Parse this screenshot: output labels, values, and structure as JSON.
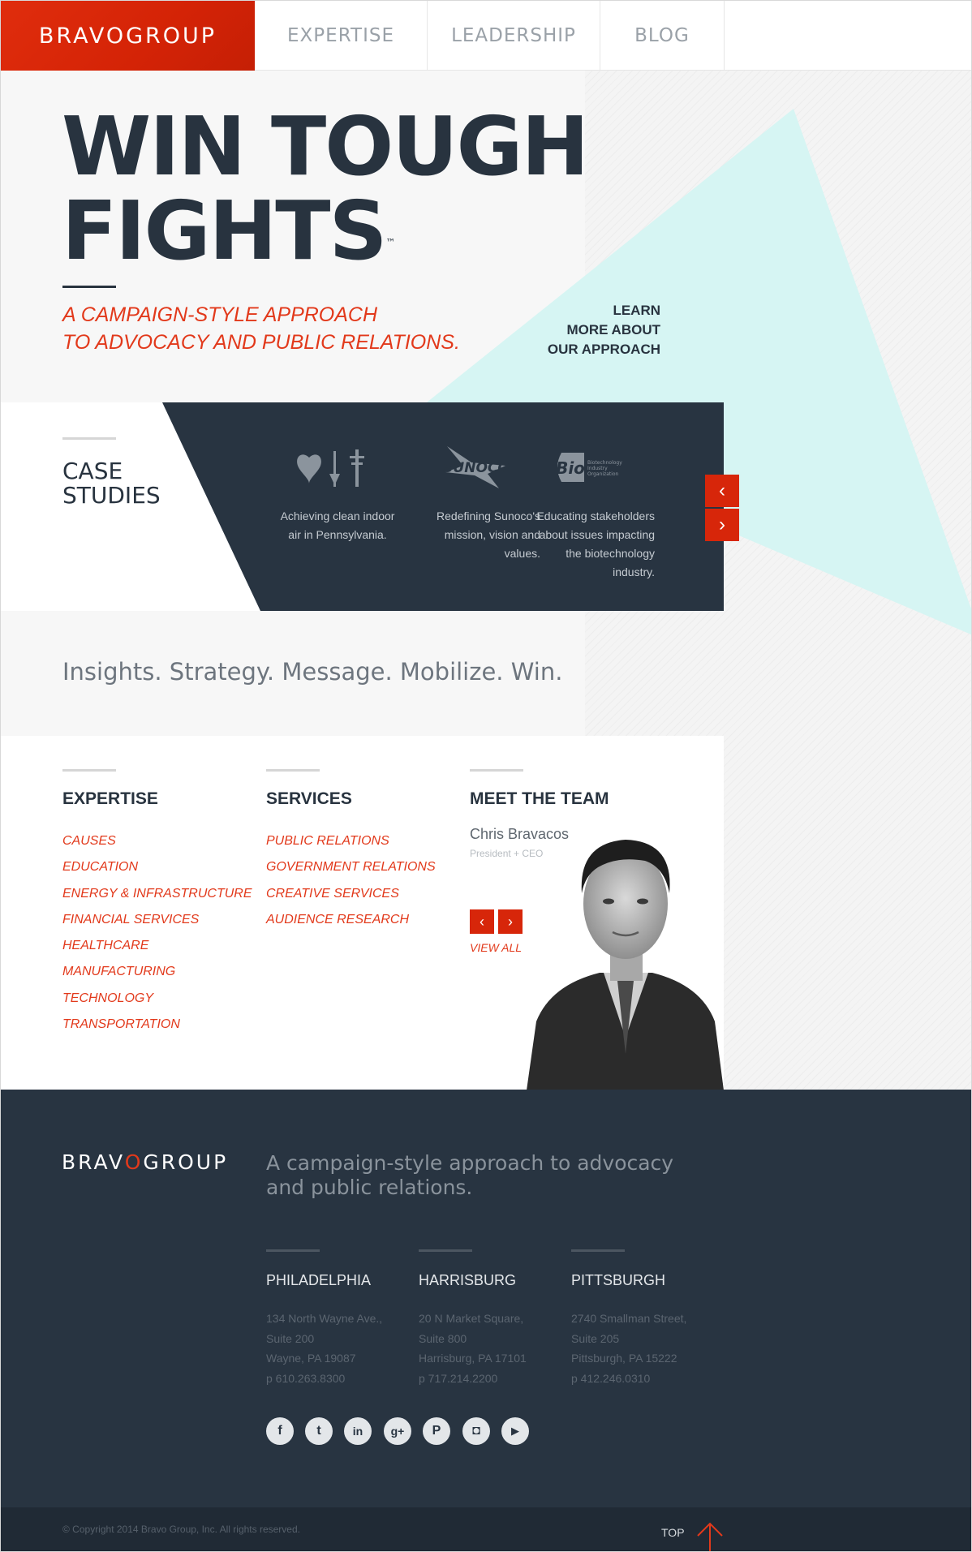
{
  "nav": {
    "logo": "BRAVOGROUP",
    "items": [
      "EXPERTISE",
      "LEADERSHIP",
      "BLOG"
    ]
  },
  "hero": {
    "title_line1": "WIN TOUGH",
    "title_line2": "FIGHTS",
    "trademark": "™",
    "subtitle_line1": "A CAMPAIGN-STYLE APPROACH",
    "subtitle_line2": "TO ADVOCACY AND PUBLIC RELATIONS.",
    "learn_more": [
      "LEARN",
      "MORE ABOUT",
      "OUR APPROACH"
    ]
  },
  "case_studies": {
    "title_line1": "CASE",
    "title_line2": "STUDIES",
    "items": [
      {
        "logo": "health-coalition-logo",
        "text": "Achieving clean indoor air in Pennsylvania."
      },
      {
        "logo": "sunoco-logo",
        "logo_text": "SUNOCO",
        "text": "Redefining Sunoco's mission, vision and values."
      },
      {
        "logo": "bio-logo",
        "logo_text": "Bio",
        "logo_subtext": "Biotechnology Industry Organization",
        "text": "Educating stakeholders about issues impacting the biotechnology industry."
      }
    ],
    "prev": "‹",
    "next": "›"
  },
  "tagline": "Insights. Strategy. Message. Mobilize. Win.",
  "expertise": {
    "heading": "EXPERTISE",
    "items": [
      "CAUSES",
      "EDUCATION",
      "ENERGY & INFRASTRUCTURE",
      "FINANCIAL SERVICES",
      "HEALTHCARE",
      "MANUFACTURING",
      "TECHNOLOGY",
      "TRANSPORTATION"
    ]
  },
  "services": {
    "heading": "SERVICES",
    "items": [
      "PUBLIC RELATIONS",
      "GOVERNMENT RELATIONS",
      "CREATIVE SERVICES",
      "AUDIENCE RESEARCH"
    ]
  },
  "team": {
    "heading": "MEET THE TEAM",
    "name": "Chris Bravacos",
    "role": "President + CEO",
    "prev": "‹",
    "next": "›",
    "view_all": "VIEW ALL"
  },
  "footer": {
    "logo_pre": "BRAV",
    "logo_o": "O",
    "logo_post": "GROUP",
    "tagline": "A campaign-style approach to advocacy and public relations.",
    "offices": [
      {
        "city": "PHILADELPHIA",
        "lines": [
          "134 North Wayne Ave.,",
          "Suite 200",
          "Wayne, PA 19087",
          "p 610.263.8300"
        ]
      },
      {
        "city": "HARRISBURG",
        "lines": [
          "20 N Market Square,",
          "Suite 800",
          "Harrisburg, PA 17101",
          "p 717.214.2200"
        ]
      },
      {
        "city": "PITTSBURGH",
        "lines": [
          "2740 Smallman Street,",
          "Suite 205",
          "Pittsburgh, PA 15222",
          "p 412.246.0310"
        ]
      }
    ],
    "social": [
      {
        "name": "facebook-icon",
        "glyph": "f"
      },
      {
        "name": "twitter-icon",
        "glyph": "t"
      },
      {
        "name": "linkedin-icon",
        "glyph": "in"
      },
      {
        "name": "google-plus-icon",
        "glyph": "g+"
      },
      {
        "name": "pinterest-icon",
        "glyph": "P"
      },
      {
        "name": "instagram-icon",
        "glyph": "◘"
      },
      {
        "name": "youtube-icon",
        "glyph": "▶"
      }
    ],
    "copyright": "© Copyright 2014 Bravo Group, Inc. All rights reserved.",
    "top": "TOP"
  },
  "colors": {
    "brand_red": "#d7260a",
    "navy": "#283441",
    "teal": "#d6f5f3"
  }
}
